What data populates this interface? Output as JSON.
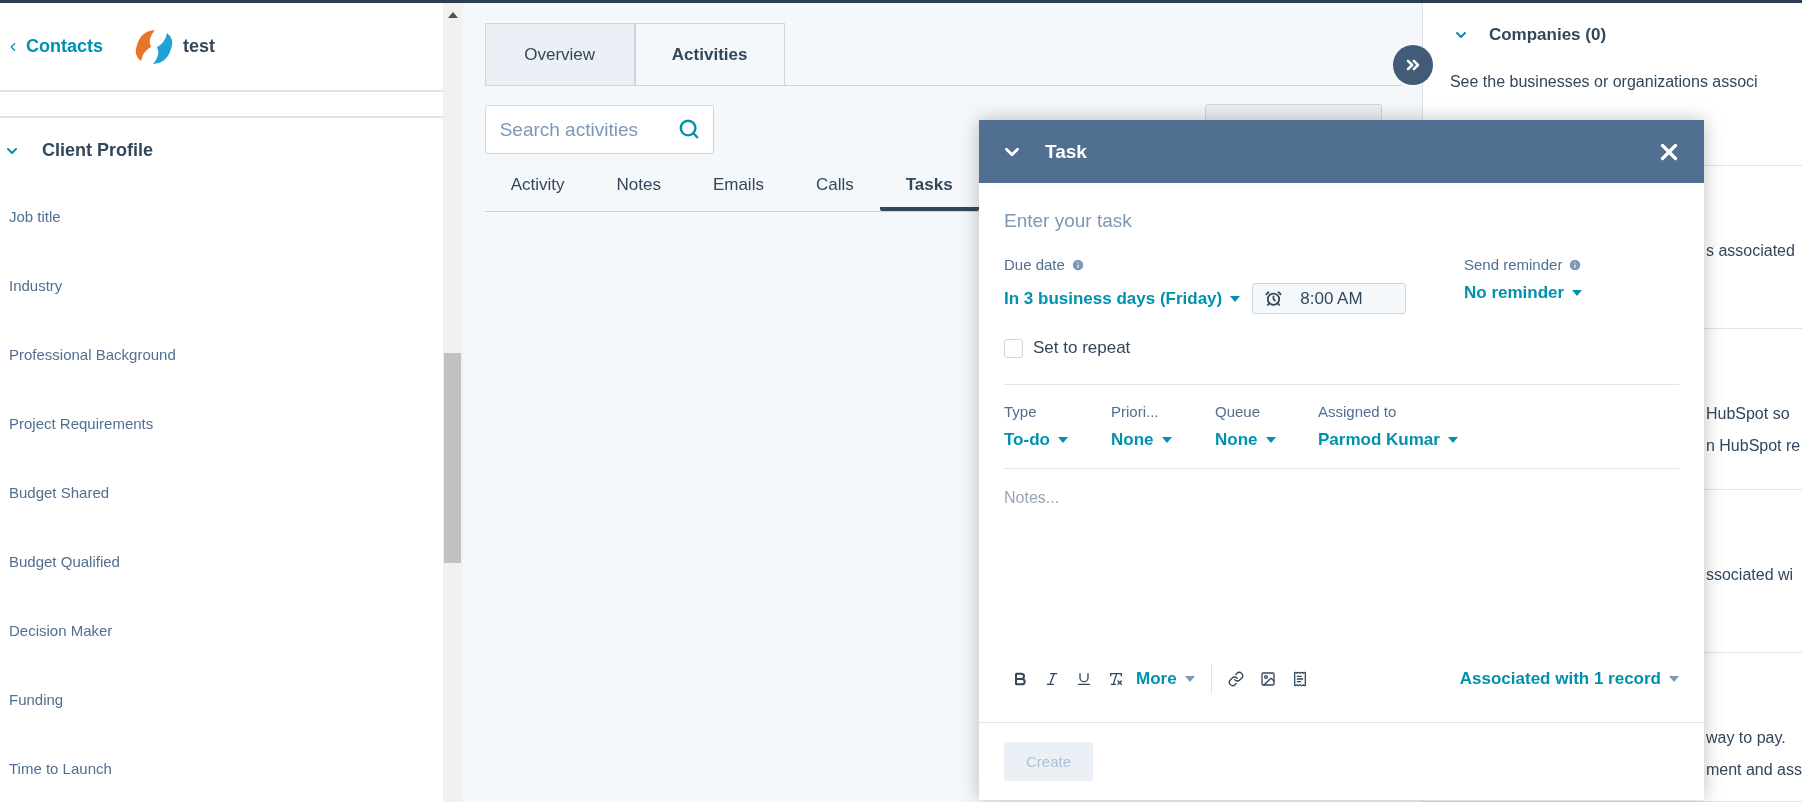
{
  "header": {
    "back_link": "Contacts",
    "record_name": "test"
  },
  "client_profile": {
    "title": "Client Profile",
    "expanded": true,
    "fields": [
      "Job title",
      "Industry",
      "Professional Background",
      "Project Requirements",
      "Budget Shared",
      "Budget Qualified",
      "Decision Maker",
      "Funding",
      "Time to Launch"
    ]
  },
  "record_tabs": [
    {
      "label": "Overview",
      "selected": false
    },
    {
      "label": "Activities",
      "selected": true
    }
  ],
  "search": {
    "placeholder": "Search activities"
  },
  "activity_tabs": [
    {
      "label": "Activity",
      "selected": false
    },
    {
      "label": "Notes",
      "selected": false
    },
    {
      "label": "Emails",
      "selected": false
    },
    {
      "label": "Calls",
      "selected": false
    },
    {
      "label": "Tasks",
      "selected": true
    }
  ],
  "right_panel": {
    "sections": [
      {
        "title": "Companies (0)",
        "expanded": true,
        "lines": [
          "See the businesses or organizations associ"
        ]
      },
      {
        "lines": [
          "s associated"
        ]
      },
      {
        "lines": [
          "HubSpot so",
          "n HubSpot re"
        ]
      },
      {
        "lines": [
          "ssociated wi"
        ]
      },
      {
        "lines": [
          "way to pay.",
          "ment and ass"
        ]
      }
    ]
  },
  "task_dialog": {
    "title": "Task",
    "task_placeholder": "Enter your task",
    "due_date": {
      "label": "Due date",
      "value": "In 3 business days (Friday)",
      "time": "8:00 AM"
    },
    "reminder": {
      "label": "Send reminder",
      "value": "No reminder"
    },
    "repeat": {
      "label": "Set to repeat",
      "checked": false
    },
    "properties": [
      {
        "label": "Type",
        "value": "To-do"
      },
      {
        "label": "Priori...",
        "value": "None"
      },
      {
        "label": "Queue",
        "value": "None"
      },
      {
        "label": "Assigned to",
        "value": "Parmod Kumar"
      }
    ],
    "notes_placeholder": "Notes...",
    "more_label": "More",
    "association": "Associated with 1 record",
    "create_button": {
      "label": "Create",
      "disabled": true
    }
  }
}
